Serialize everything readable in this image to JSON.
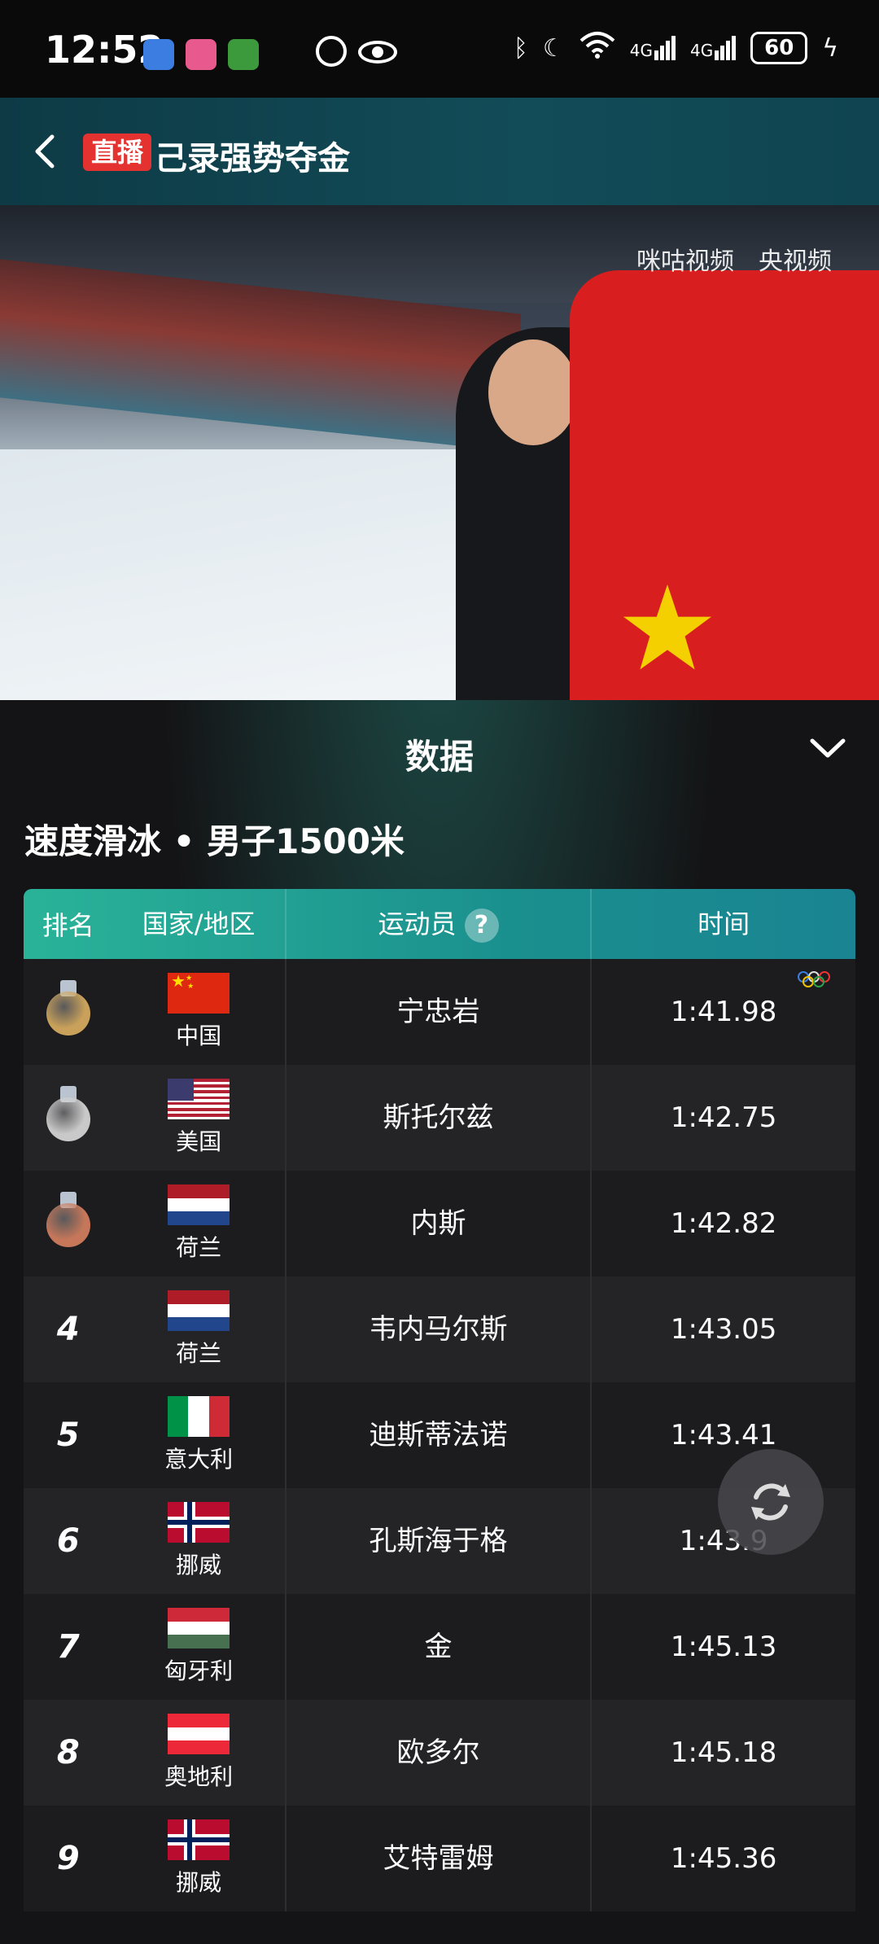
{
  "status_bar": {
    "time": "12:52",
    "network_1": "4G",
    "network_2": "4G",
    "battery": "60"
  },
  "header": {
    "live_badge": "直播",
    "title": "己录强势夺金"
  },
  "video": {
    "watermark_1": "咪咕视频",
    "watermark_2": "央视频"
  },
  "panel": {
    "title": "数据",
    "event": "速度滑冰 • 男子1500米"
  },
  "table": {
    "headers": {
      "rank": "排名",
      "country": "国家/地区",
      "athlete": "运动员",
      "time": "时间"
    },
    "rows": [
      {
        "rank": "",
        "medal": "gold",
        "country": "中国",
        "flag": "china-flag",
        "athlete": "宁忠岩",
        "time": "1:41.98",
        "olympic_record": true
      },
      {
        "rank": "",
        "medal": "silver",
        "country": "美国",
        "flag": "usa-flag",
        "athlete": "斯托尔兹",
        "time": "1:42.75"
      },
      {
        "rank": "",
        "medal": "bronze",
        "country": "荷兰",
        "flag": "netherlands-flag",
        "athlete": "内斯",
        "time": "1:42.82"
      },
      {
        "rank": "4",
        "country": "荷兰",
        "flag": "netherlands-flag",
        "athlete": "韦内马尔斯",
        "time": "1:43.05"
      },
      {
        "rank": "5",
        "country": "意大利",
        "flag": "italy-flag",
        "athlete": "迪斯蒂法诺",
        "time": "1:43.41"
      },
      {
        "rank": "6",
        "country": "挪威",
        "flag": "norway-flag",
        "athlete": "孔斯海于格",
        "time": "1:43.9"
      },
      {
        "rank": "7",
        "country": "匈牙利",
        "flag": "hungary-flag",
        "athlete": "金",
        "time": "1:45.13"
      },
      {
        "rank": "8",
        "country": "奥地利",
        "flag": "austria-flag",
        "athlete": "欧多尔",
        "time": "1:45.18"
      },
      {
        "rank": "9",
        "country": "挪威",
        "flag": "norway-flag",
        "athlete": "艾特雷姆",
        "time": "1:45.36"
      }
    ]
  },
  "colors": {
    "gold": "#c9a15a",
    "silver": "#c9c9c9",
    "bronze": "#c6775a",
    "header_teal": "#1a8f8e",
    "live_red": "#e3322f"
  }
}
